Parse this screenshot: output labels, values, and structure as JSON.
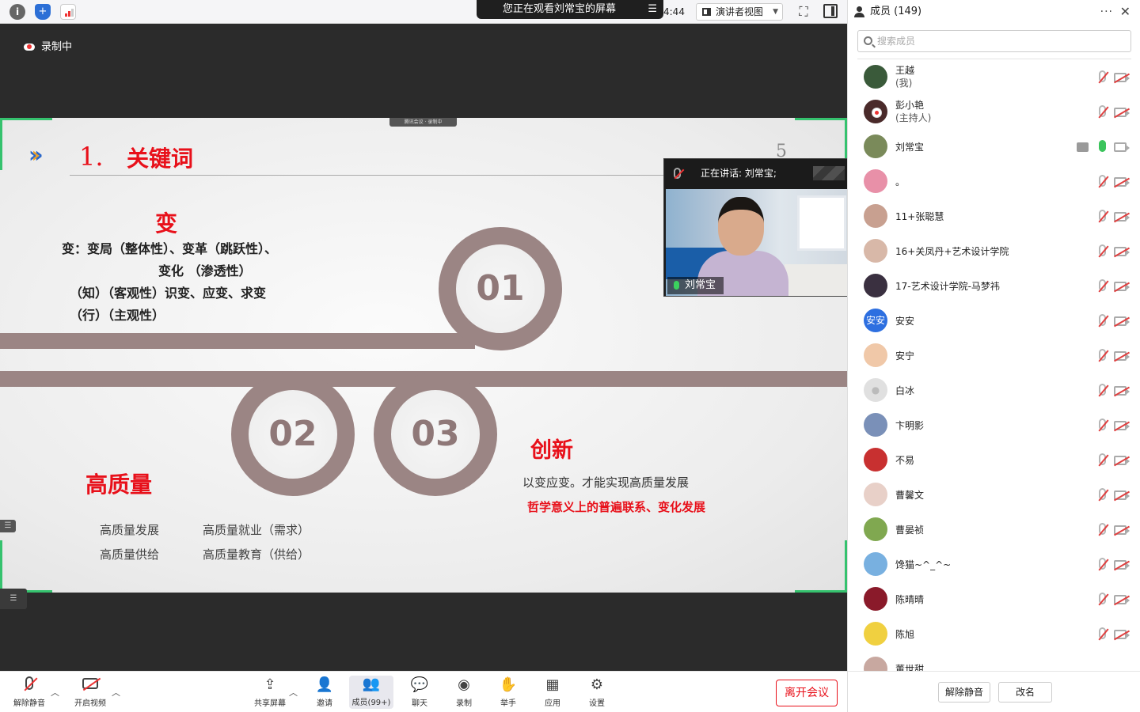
{
  "top": {
    "share_banner": "您正在观看刘常宝的屏幕",
    "timer": "4:44",
    "view_mode": "演讲者视图"
  },
  "stage": {
    "recording": "录制中",
    "mini_recording": "腾讯会议 · 录制中"
  },
  "slide": {
    "section_number": "1.",
    "section_title": "关键词",
    "page_number": "5",
    "rings": [
      "01",
      "02",
      "03"
    ],
    "change_heading": "变",
    "change_lines": [
      "变：变局（整体性）、变革（跳跃性）、",
      "变化 （渗透性）",
      "（知）（客观性）识变、应变、求变",
      "（行）（主观性）"
    ],
    "quality_heading": "高质量",
    "quality_items": [
      "高质量发展",
      "高质量就业（需求）",
      "高质量供给",
      "高质量教育（供给）"
    ],
    "innovation_heading": "创新",
    "innovation_line": "以变应变。才能实现高质量发展",
    "innovation_red": "哲学意义上的普遍联系、变化发展"
  },
  "speaker": {
    "status": "正在讲话: 刘常宝;",
    "name": "刘常宝"
  },
  "toolbar": {
    "unmute": "解除静音",
    "start_video": "开启视频",
    "share": "共享屏幕",
    "invite": "邀请",
    "members": "成员(99+)",
    "chat": "聊天",
    "record": "录制",
    "raise_hand": "举手",
    "apps": "应用",
    "settings": "设置",
    "leave": "离开会议"
  },
  "panel": {
    "title": "成员 (149)",
    "search_placeholder": "搜索成员",
    "members": [
      {
        "name": "王越",
        "sub": "(我)",
        "color": "#3a5a3a"
      },
      {
        "name": "彭小艳",
        "sub": "(主持人)",
        "color": "#4a2a2a"
      },
      {
        "name": "刘常宝",
        "sub": "",
        "color": "#7a8a5a"
      },
      {
        "name": "。",
        "sub": "",
        "color": "#e890a8"
      },
      {
        "name": "11+张聪慧",
        "sub": "",
        "color": "#c8a090"
      },
      {
        "name": "16+关凤丹+艺术设计学院",
        "sub": "",
        "color": "#d8b8a8"
      },
      {
        "name": "17-艺术设计学院-马梦祎",
        "sub": "",
        "color": "#3a3040"
      },
      {
        "name": "安安",
        "sub": "",
        "color": "#2d6fe0"
      },
      {
        "name": "安宁",
        "sub": "",
        "color": "#f0c8a8"
      },
      {
        "name": "白冰",
        "sub": "",
        "color": "#e0e0e0"
      },
      {
        "name": "卞明影",
        "sub": "",
        "color": "#7a90b8"
      },
      {
        "name": "不易",
        "sub": "",
        "color": "#c83030"
      },
      {
        "name": "曹馨文",
        "sub": "",
        "color": "#e8d0c8"
      },
      {
        "name": "曹晏祯",
        "sub": "",
        "color": "#80a850"
      },
      {
        "name": "馋猫~^_^~",
        "sub": "",
        "color": "#78b0e0"
      },
      {
        "name": "陈晴晴",
        "sub": "",
        "color": "#8a1a2a"
      },
      {
        "name": "陈旭",
        "sub": "",
        "color": "#f0d040"
      },
      {
        "name": "董世甜",
        "sub": "",
        "color": "#c8a8a0"
      }
    ],
    "unmute_all": "解除静音",
    "rename": "改名"
  }
}
